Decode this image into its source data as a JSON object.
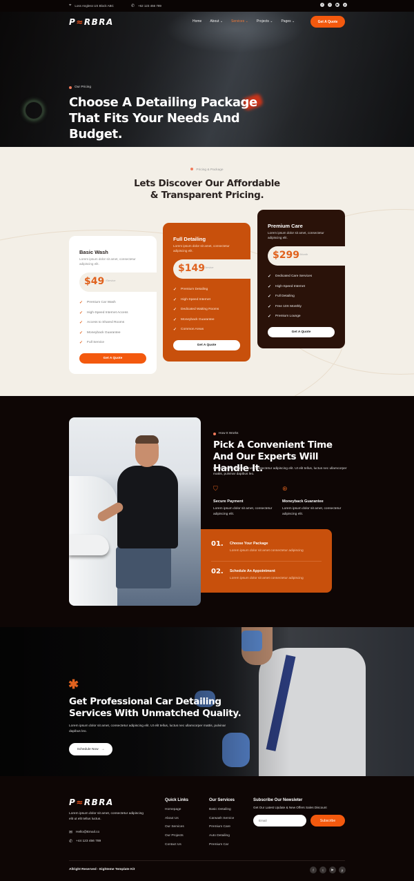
{
  "topbar": {
    "location": "Loss Angless US Block ABC",
    "phone": "+62 123 456 789",
    "social": [
      "facebook-icon",
      "twitter-icon",
      "youtube-icon",
      "pinterest-icon"
    ]
  },
  "brand": {
    "logo_a": "P",
    "logo_z": "≈",
    "logo_b": "RBRA",
    "accent": "#f3590e",
    "dark": "#2a1209"
  },
  "nav": {
    "items": [
      {
        "label": "Home",
        "active": false,
        "dropdown": false
      },
      {
        "label": "About",
        "active": false,
        "dropdown": true
      },
      {
        "label": "Services",
        "active": true,
        "dropdown": true
      },
      {
        "label": "Projects",
        "active": false,
        "dropdown": true
      },
      {
        "label": "Pages",
        "active": false,
        "dropdown": true
      }
    ],
    "cta": "Get A Quote"
  },
  "hero": {
    "tag": "Our Pricing",
    "title": "Choose A Detailing Package That Fits Your Needs And Budget."
  },
  "pricing": {
    "tag": "Pricing & Package",
    "title": "Lets Discover Our Affordable & Transparent Pricing.",
    "plans": [
      {
        "name": "Basic Wash",
        "desc": "Lorem ipsum dolor sit amet, consectetur adipiscing elit.",
        "price": "$49",
        "period": "/Service",
        "features": [
          "Premium Car Wash",
          "High-Speed Internet Access",
          "Access to Shared Rooms",
          "Moneyback Guarantee",
          "Full Service"
        ],
        "button": "Get A Quote"
      },
      {
        "name": "Full Detailing",
        "desc": "Lorem ipsum dolor sit amet, consectetur adipiscing elit.",
        "price": "$149",
        "period": "/Service",
        "features": [
          "Premium Detailing",
          "High-Speed Internet",
          "Dedicated Waiting Rooms",
          "Moneyback Guarantee",
          "Common Areas"
        ],
        "button": "Get A Quote"
      },
      {
        "name": "Premium Care",
        "desc": "Lorem ipsum dolor sit amet, consectetur adipiscing elit.",
        "price": "$299",
        "period": "/Month",
        "features": [
          "Dedicated Care Services",
          "High-Speed Internet",
          "Full Detailing",
          "Free 10X Monthly",
          "Premium Lounge"
        ],
        "button": "Get A Quote"
      }
    ]
  },
  "how": {
    "tag": "How It Works",
    "title": "Pick A Convenient Time And Our Experts Will Handle It.",
    "desc": "Lorem ipsum dolor sit amet, consectetur adipiscing elit. Ut elit tellus, luctus nec ullamcorper mattis, pulvinar dapibus leo.",
    "features": [
      {
        "icon": "shield-check-icon",
        "title": "Secure Payment",
        "desc": "Lorem ipsum dolor sit amet, consectetur adipiscing elit."
      },
      {
        "icon": "money-badge-icon",
        "title": "Moneyback Guarantee",
        "desc": "Lorem ipsum dolor sit amet, consectetur adipiscing elit."
      }
    ],
    "steps": [
      {
        "num": "01.",
        "title": "Choose Your Package",
        "desc": "Lorem ipsum dolor sit amet consectetur adipiscing"
      },
      {
        "num": "02.",
        "title": "Schedule An Appointment",
        "desc": "Lorem ipsum dolor sit amet consectetur adipiscing"
      }
    ]
  },
  "cta": {
    "title": "Get Professional Car Detailing Services With Unmatched Quality.",
    "desc": "Lorem ipsum dolor sit amet, consectetur adipiscing elit. Ut elit tellus, luctus nec ullamcorper mattis, pulvinar dapibus leo.",
    "button": "Schedule Now",
    "arrow": "→"
  },
  "footer": {
    "about": "Lorem ipsum dolor sit amet, consectetur adipiscing elit ut elit tellus luctus.",
    "email": "Hello@Email.co",
    "phone": "+44 123 456 789",
    "quick_links": {
      "title": "Quick Links",
      "items": [
        "Homepage",
        "About Us",
        "Our Services",
        "Our Projects",
        "Contact Us"
      ]
    },
    "services": {
      "title": "Our Services",
      "items": [
        "Basic Detailing",
        "Carwash Service",
        "Premium Care",
        "Auto Detailing",
        "Premium Car"
      ]
    },
    "newsletter": {
      "title": "Subscribe Our Newsleter",
      "desc": "Get Our Latest Update & New Offers Sales Discount",
      "placeholder": "Email",
      "button": "Subscribe"
    },
    "copyright": "Allright Reserved - Eighteme Template Kit"
  }
}
